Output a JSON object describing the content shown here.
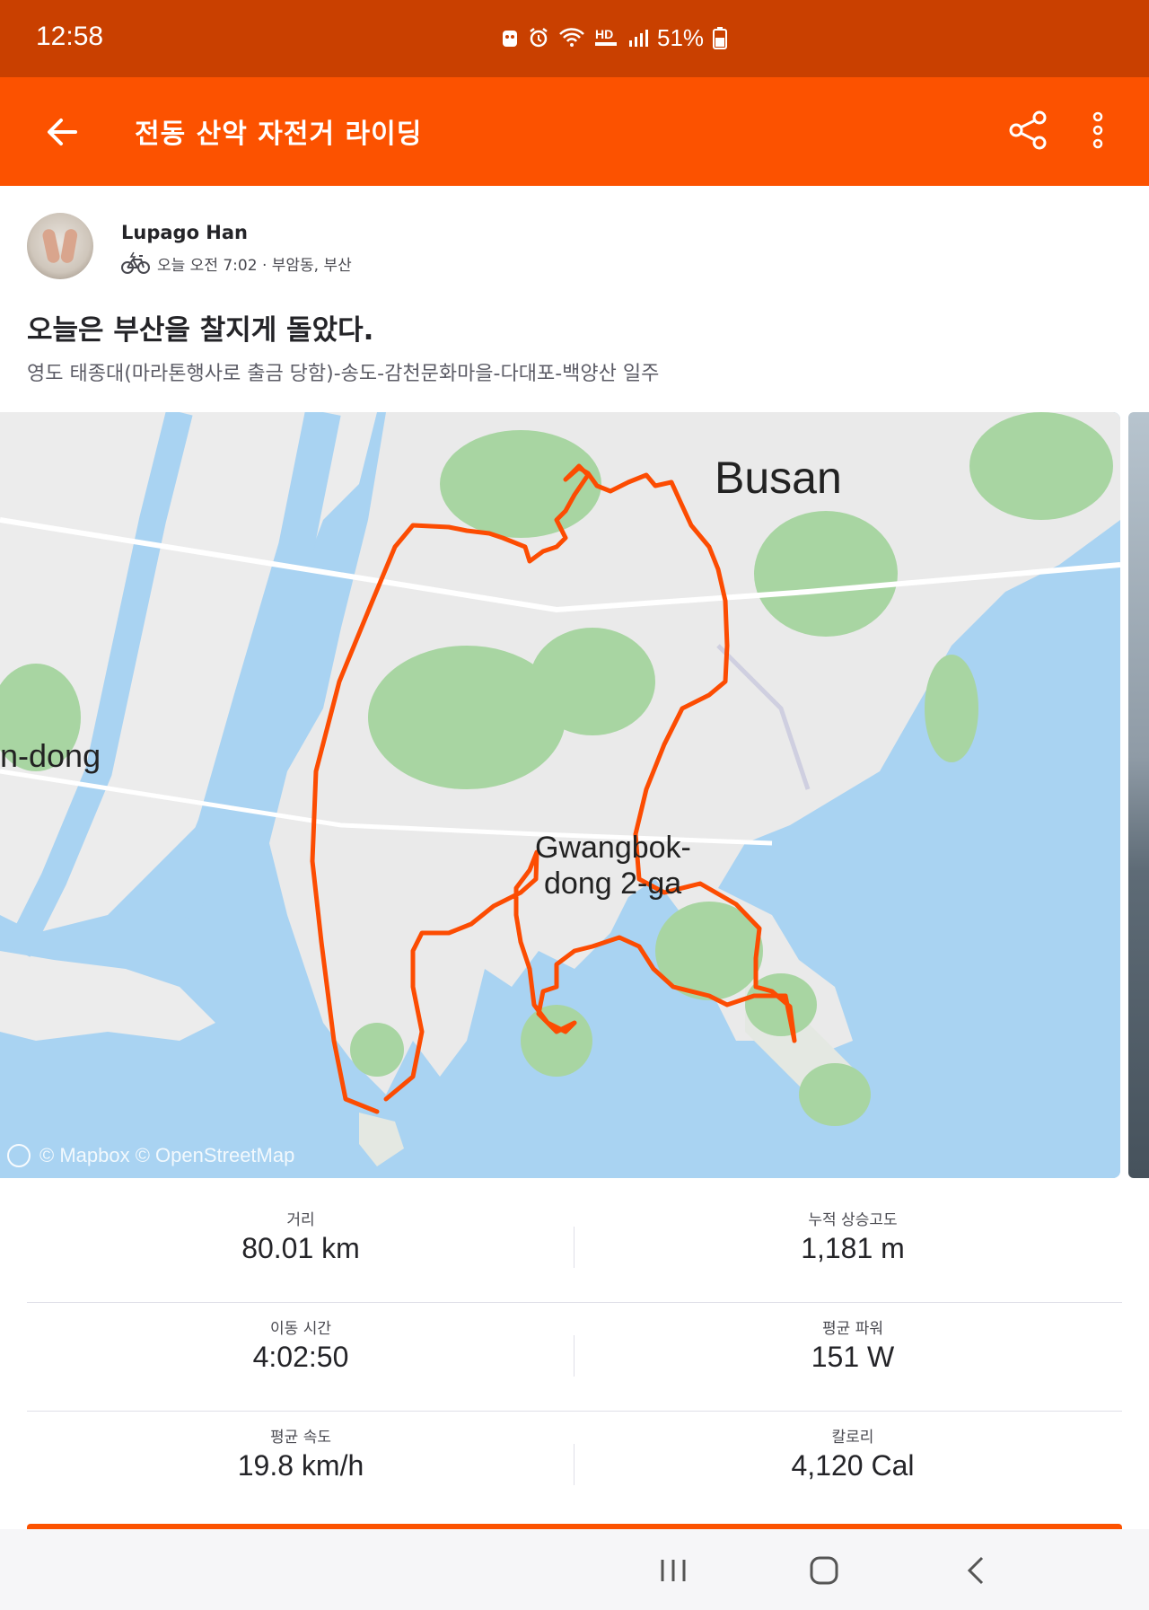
{
  "status_bar": {
    "time": "12:58",
    "battery": "51%",
    "icons": [
      "android-notify-icon",
      "alarm-icon",
      "wifi-icon",
      "hd-voice-icon",
      "signal-icon",
      "battery-icon"
    ],
    "hd_label": "HD"
  },
  "app_bar": {
    "title": "전동 산악 자전거 라이딩",
    "background": "#fc5200"
  },
  "athlete": {
    "name": "Lupago Han",
    "meta": "오늘 오전 7:02 · 부암동, 부산",
    "activity_icon": "e-mountain-bike-icon"
  },
  "activity": {
    "title": "오늘은 부산을 찰지게 돌았다.",
    "description": "영도 태종대(마라톤행사로 출금 당함)-송도-감천문화마을-다대포-백양산 일주"
  },
  "map": {
    "labels": {
      "busan": "Busan",
      "dong": "n-dong",
      "gwangbok_1": "Gwangbok-",
      "gwangbok_2": "dong 2-ga"
    },
    "attribution": "© Mapbox © OpenStreetMap",
    "route_color": "#fc4c02"
  },
  "stats": [
    [
      {
        "label": "거리",
        "value": "80.01 km"
      },
      {
        "label": "누적 상승고도",
        "value": "1,181 m"
      }
    ],
    [
      {
        "label": "이동 시간",
        "value": "4:02:50"
      },
      {
        "label": "평균 파워",
        "value": "151 W"
      }
    ],
    [
      {
        "label": "평균 속도",
        "value": "19.8 km/h"
      },
      {
        "label": "칼로리",
        "value": "4,120 Cal"
      }
    ]
  ],
  "nav": [
    "recent-apps-icon",
    "home-icon",
    "back-icon"
  ]
}
